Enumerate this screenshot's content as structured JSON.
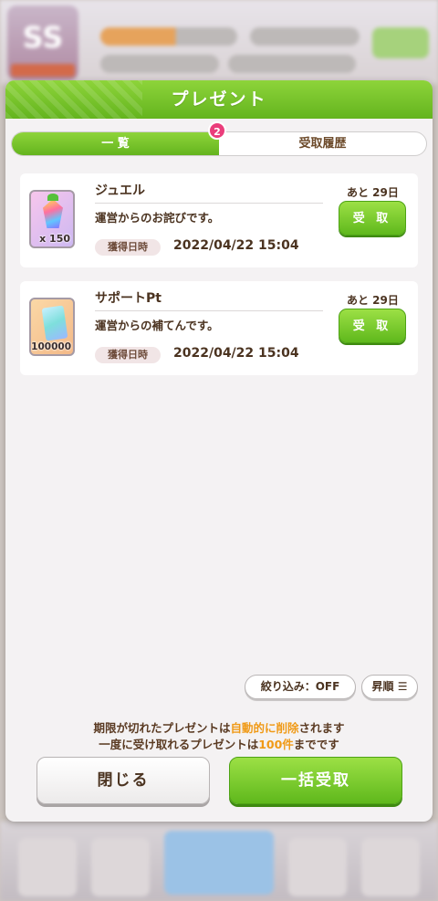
{
  "background": {
    "rank_badge": "SS",
    "rank_sub": "",
    "menu_label": ""
  },
  "dialog": {
    "title": "プレゼント",
    "tabs": [
      {
        "label": "一 覧",
        "badge": "2",
        "active": true
      },
      {
        "label": "受取履歴",
        "active": false
      }
    ],
    "items": [
      {
        "name": "ジュエル",
        "icon": "jewel-icon",
        "quantity": "x 150",
        "description": "運営からのお詫びです。",
        "date_label": "獲得日時",
        "date": "2022/04/22 15:04",
        "remaining": "あと 29日",
        "receive_label": "受 取"
      },
      {
        "name": "サポートPt",
        "icon": "support-pt-icon",
        "quantity": "x100000",
        "description": "運営からの補てんです。",
        "date_label": "獲得日時",
        "date": "2022/04/22 15:04",
        "remaining": "あと 29日",
        "receive_label": "受 取"
      }
    ],
    "filter_label": "絞り込み：OFF",
    "sort_label": "昇順",
    "notice": {
      "line1_a": "期限が切れたプレゼントは",
      "line1_hl": "自動的に削除",
      "line1_b": "されます",
      "line2_a": "一度に受け取れるプレゼントは",
      "line2_hl": "100件",
      "line2_b": "までです"
    },
    "close_label": "閉じる",
    "bulk_receive_label": "一括受取"
  },
  "colors": {
    "accent_green": "#64b41e",
    "badge_pink": "#ea3d7b",
    "highlight_orange": "#f09a17",
    "text_brown": "#4b3320"
  }
}
